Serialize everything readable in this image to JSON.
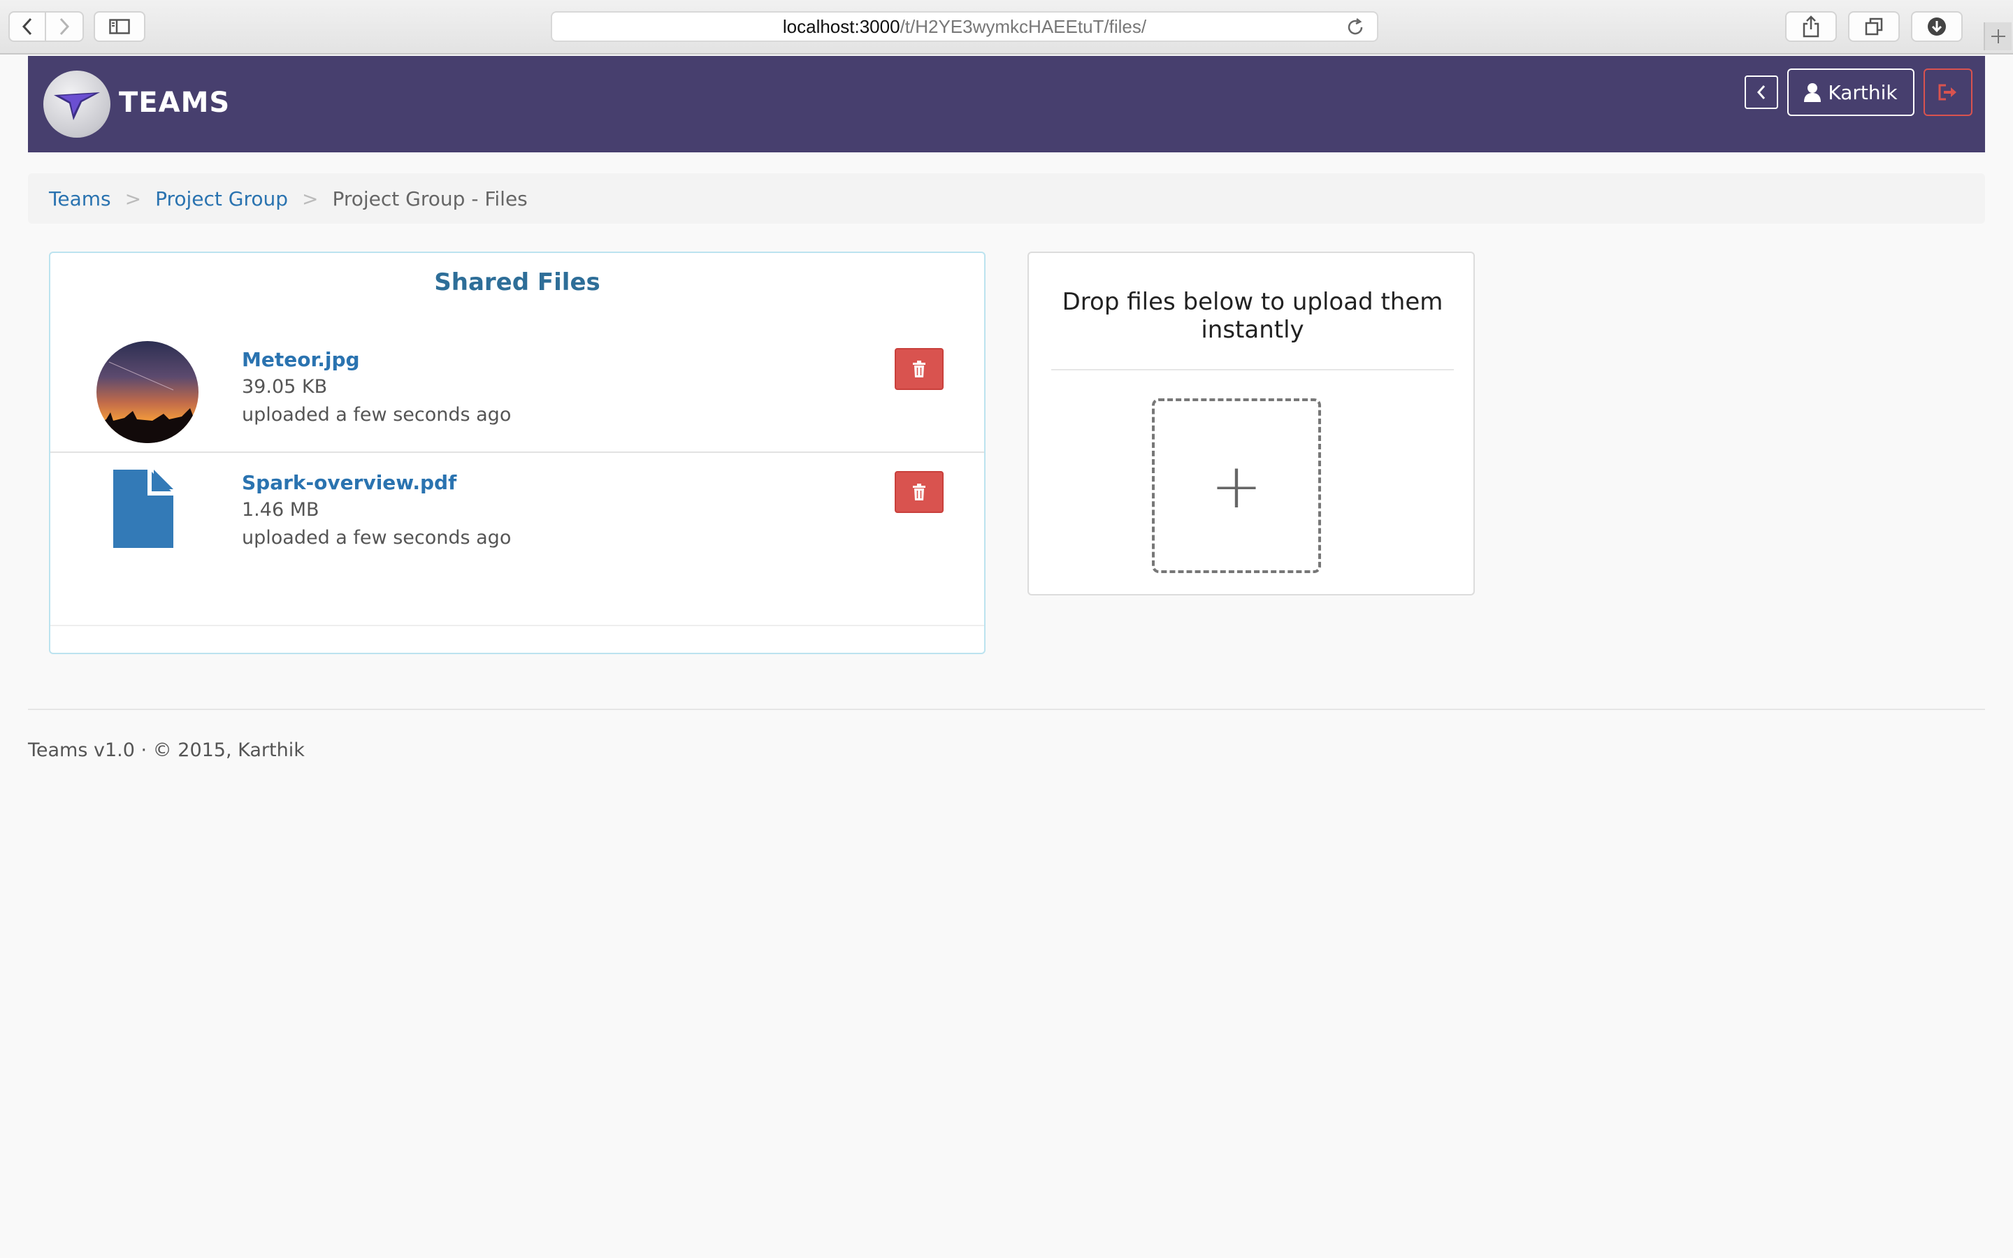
{
  "browser": {
    "url_host": "localhost:3000",
    "url_path": "/t/H2YE3wymkcHAEEtuT/files/"
  },
  "header": {
    "brand": "TEAMS",
    "user_name": "Karthik",
    "colors": {
      "bar": "#473f6e",
      "danger": "#d9534f"
    }
  },
  "breadcrumb": {
    "items": [
      {
        "label": "Teams"
      },
      {
        "label": "Project Group"
      },
      {
        "label": "Project Group - Files"
      }
    ],
    "separator": ">"
  },
  "files": {
    "title": "Shared Files",
    "items": [
      {
        "name": "Meteor.jpg",
        "size": "39.05 KB",
        "uploaded": "uploaded a few seconds ago",
        "icon": "image-thumbnail"
      },
      {
        "name": "Spark-overview.pdf",
        "size": "1.46 MB",
        "uploaded": "uploaded a few seconds ago",
        "icon": "file-icon"
      }
    ]
  },
  "upload": {
    "title": "Drop files below to upload them instantly",
    "drop_symbol": "+"
  },
  "footer": {
    "text": "Teams v1.0 · © 2015, Karthik"
  }
}
